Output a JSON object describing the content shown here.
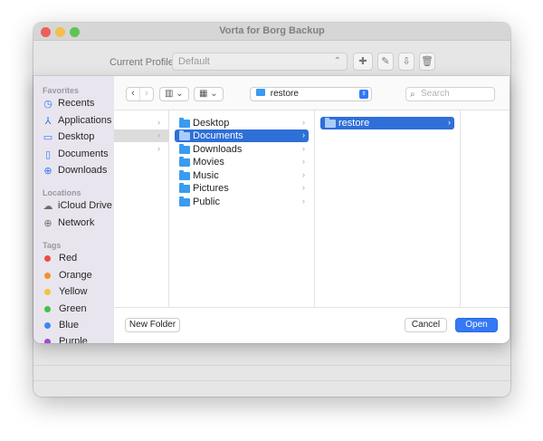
{
  "parent_window": {
    "title": "Vorta for Borg Backup",
    "profile_label": "Current Profile:",
    "profile_value": "Default",
    "buttons": [
      "plus-icon",
      "edit-icon",
      "import-icon",
      "trash-icon"
    ]
  },
  "dialog": {
    "sidebar": {
      "favorites_header": "Favorites",
      "favorites": [
        {
          "label": "Recents",
          "icon": "clock-icon"
        },
        {
          "label": "Applications",
          "icon": "applications-icon"
        },
        {
          "label": "Desktop",
          "icon": "desktop-icon"
        },
        {
          "label": "Documents",
          "icon": "document-icon"
        },
        {
          "label": "Downloads",
          "icon": "download-icon"
        }
      ],
      "locations_header": "Locations",
      "locations": [
        {
          "label": "iCloud Drive",
          "icon": "cloud-icon"
        },
        {
          "label": "Network",
          "icon": "globe-icon"
        }
      ],
      "tags_header": "Tags",
      "tags": [
        {
          "label": "Red",
          "color": "#f04a44"
        },
        {
          "label": "Orange",
          "color": "#f4902a"
        },
        {
          "label": "Yellow",
          "color": "#f5c33b"
        },
        {
          "label": "Green",
          "color": "#43c14b"
        },
        {
          "label": "Blue",
          "color": "#3a87f3"
        },
        {
          "label": "Purple",
          "color": "#a34ad1"
        }
      ]
    },
    "toolbar": {
      "back_glyph": "‹",
      "forward_glyph": "›",
      "view_columns_glyph": "▥ ⌄",
      "view_grid_glyph": "▦ ⌄",
      "path": "restore",
      "search_placeholder": "Search"
    },
    "column2": {
      "items": [
        {
          "label": "Desktop",
          "selected": false
        },
        {
          "label": "Documents",
          "selected": true
        },
        {
          "label": "Downloads",
          "selected": false
        },
        {
          "label": "Movies",
          "selected": false
        },
        {
          "label": "Music",
          "selected": false
        },
        {
          "label": "Pictures",
          "selected": false
        },
        {
          "label": "Public",
          "selected": false
        }
      ]
    },
    "column3": {
      "items": [
        {
          "label": "restore",
          "selected": true
        }
      ]
    },
    "footer": {
      "new_folder": "New Folder",
      "cancel": "Cancel",
      "open": "Open"
    }
  }
}
